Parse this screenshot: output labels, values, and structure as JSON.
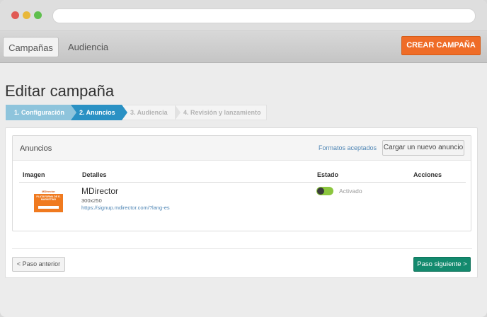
{
  "nav": {
    "tabs": [
      {
        "label": "Campañas",
        "active": true
      },
      {
        "label": "Audiencia",
        "active": false
      }
    ],
    "create_button": "CREAR CAMPAÑA"
  },
  "page_title": "Editar campaña",
  "steps": [
    {
      "label": "1. Configuración",
      "state": "done"
    },
    {
      "label": "2. Anuncios",
      "state": "active"
    },
    {
      "label": "3. Audiencia",
      "state": "pending"
    },
    {
      "label": "4. Revisión y lanzamiento",
      "state": "pending"
    }
  ],
  "ads_panel": {
    "title": "Anuncios",
    "formats_link": "Formatos aceptados",
    "upload_button": "Cargar un nuevo anuncio",
    "columns": [
      "Imagen",
      "Detalles",
      "Estado",
      "Acciones"
    ],
    "rows": [
      {
        "thumb_brand": "MDirector",
        "thumb_text": "PLATAFORMA DE E-MARKETING",
        "name": "MDirector",
        "size": "300x250",
        "url": "https://signup.mdirector.com/?lang-es",
        "status": "Activado",
        "active": true
      }
    ]
  },
  "footer": {
    "prev_button": "< Paso anterior",
    "next_button": "Paso siguiente >"
  },
  "colors": {
    "accent_orange": "#ef6c27",
    "step_active": "#2a91c4",
    "step_done": "#8ec4dc",
    "next_green": "#138a6e",
    "toggle_green": "#8cc63f"
  }
}
